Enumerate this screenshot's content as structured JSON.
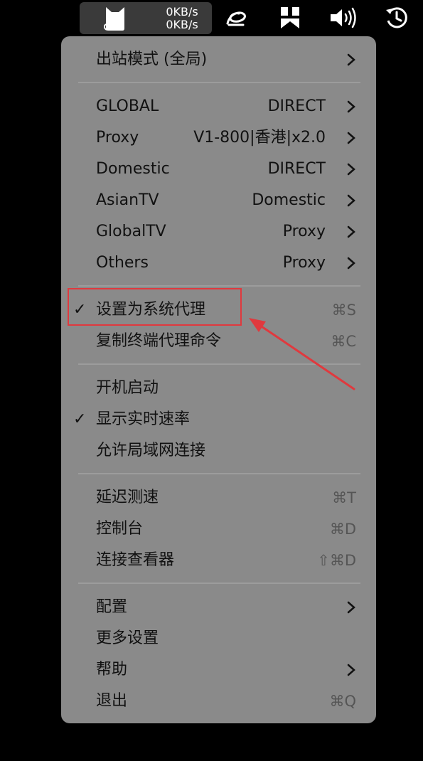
{
  "menubar": {
    "upload_speed": "0KB/s",
    "download_speed": "0KB/s",
    "icons": [
      "clash-cat-icon",
      "gesture-icon",
      "bookmark-app-icon",
      "volume-icon",
      "time-machine-icon"
    ]
  },
  "menu": {
    "outbound_mode": "出站模式 (全局)",
    "proxies": [
      {
        "name": "GLOBAL",
        "value": "DIRECT"
      },
      {
        "name": "Proxy",
        "value": "V1-800|香港|x2.0"
      },
      {
        "name": "Domestic",
        "value": "DIRECT"
      },
      {
        "name": "AsianTV",
        "value": "Domestic"
      },
      {
        "name": "GlobalTV",
        "value": "Proxy"
      },
      {
        "name": "Others",
        "value": "Proxy"
      }
    ],
    "set_system_proxy": {
      "label": "设置为系统代理",
      "shortcut": "⌘S",
      "checked": true
    },
    "copy_terminal": {
      "label": "复制终端代理命令",
      "shortcut": "⌘C"
    },
    "start_at_login": {
      "label": "开机启动"
    },
    "show_speed": {
      "label": "显示实时速率",
      "checked": true
    },
    "allow_lan": {
      "label": "允许局域网连接"
    },
    "benchmark": {
      "label": "延迟测速",
      "shortcut": "⌘T"
    },
    "dashboard": {
      "label": "控制台",
      "shortcut": "⌘D"
    },
    "connections": {
      "label": "连接查看器",
      "shortcut": "⇧⌘D"
    },
    "config": {
      "label": "配置"
    },
    "more_settings": {
      "label": "更多设置"
    },
    "help": {
      "label": "帮助"
    },
    "quit": {
      "label": "退出",
      "shortcut": "⌘Q"
    },
    "check_mark": "✓"
  },
  "colors": {
    "menu_bg": "#8a8a8a",
    "annotation": "#e0393e"
  }
}
